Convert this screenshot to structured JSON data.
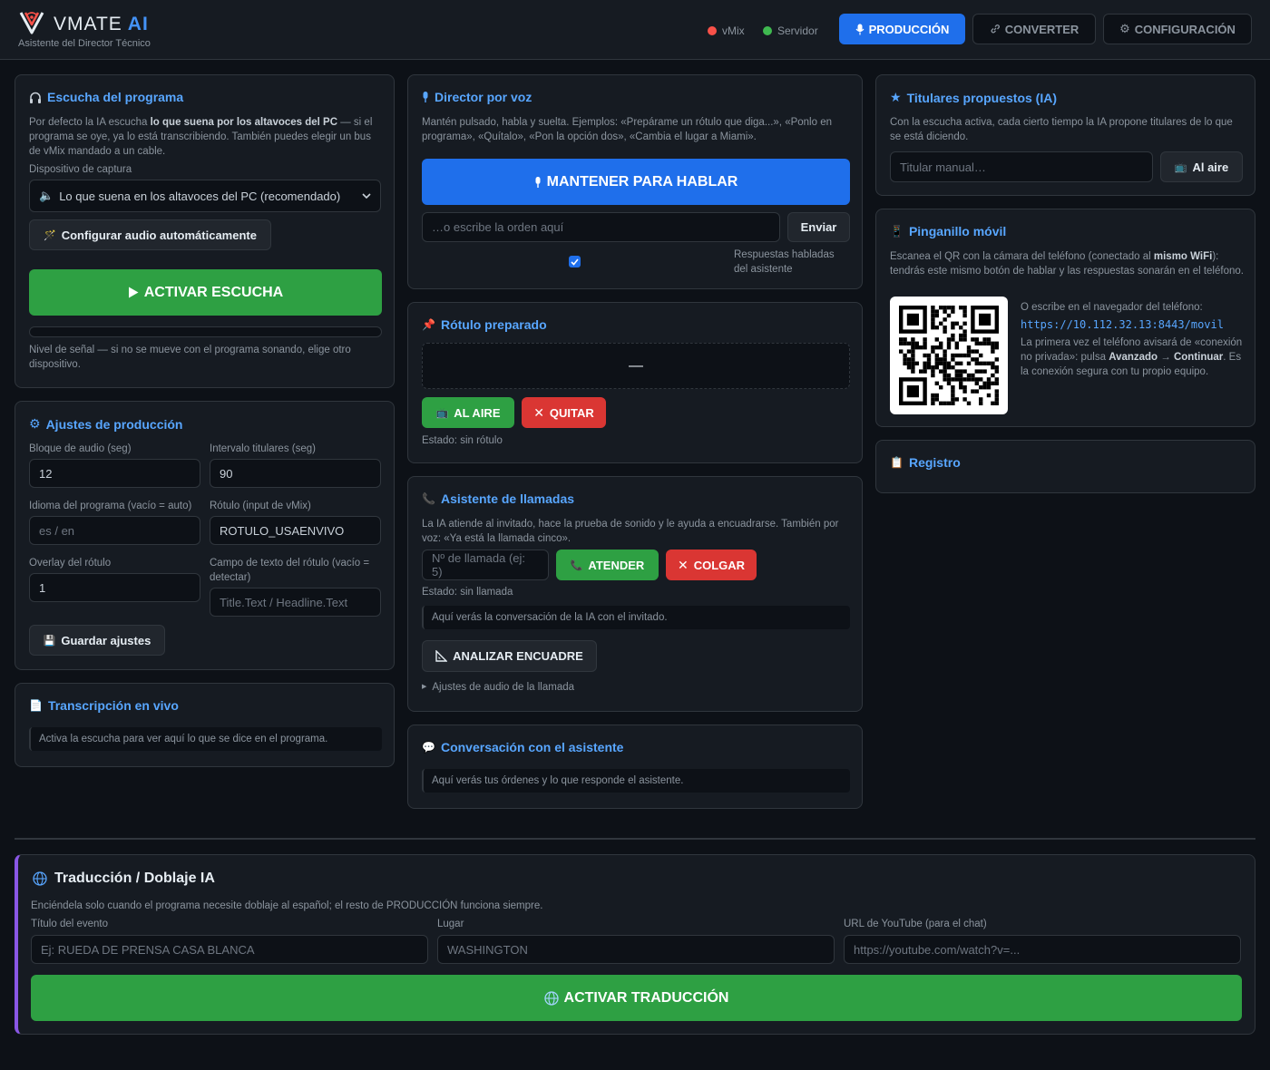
{
  "header": {
    "brand_name": "VMATE",
    "brand_ai": "AI",
    "subtitle": "Asistente del Director Técnico",
    "status_vmix": "vMix",
    "status_server": "Servidor",
    "nav": {
      "produccion": "PRODUCCIÓN",
      "converter": "CONVERTER",
      "configuracion": "CONFIGURACIÓN"
    }
  },
  "colors": {
    "accent": "#1f6feb",
    "link": "#58a6ff",
    "green": "#2ea043",
    "red": "#da3633",
    "purple": "#8957e5",
    "status_vmix": "#f85149",
    "status_server": "#3fb950"
  },
  "escucha": {
    "title": "Escucha del programa",
    "desc_1": "Por defecto la IA escucha ",
    "desc_bold": "lo que suena por los altavoces del PC",
    "desc_2": " — si el programa se oye, ya lo está transcribiendo. También puedes elegir un bus de vMix mandado a un cable.",
    "device_label": "Dispositivo de captura",
    "device_selected": "Lo que suena en los altavoces del PC (recomendado)",
    "auto_audio_btn": "Configurar audio automáticamente",
    "activate_btn": "ACTIVAR ESCUCHA",
    "level_hint": "Nivel de señal — si no se mueve con el programa sonando, elige otro dispositivo."
  },
  "ajustes": {
    "title": "Ajustes de producción",
    "audio_block_label": "Bloque de audio (seg)",
    "audio_block_value": "12",
    "interval_label": "Intervalo titulares (seg)",
    "interval_value": "90",
    "language_label": "Idioma del programa (vacío = auto)",
    "language_placeholder": "es / en",
    "rotulo_label": "Rótulo (input de vMix)",
    "rotulo_value": "ROTULO_USAENVIVO",
    "overlay_label": "Overlay del rótulo",
    "overlay_value": "1",
    "field_label": "Campo de texto del rótulo (vacío = detectar)",
    "field_placeholder": "Title.Text / Headline.Text",
    "save_btn": "Guardar ajustes"
  },
  "transcripcion": {
    "title": "Transcripción en vivo",
    "placeholder": "Activa la escucha para ver aquí lo que se dice en el programa."
  },
  "director": {
    "title": "Director por voz",
    "desc": "Mantén pulsado, habla y suelta. Ejemplos: «Prepárame un rótulo que diga...», «Ponlo en programa», «Quítalo», «Pon la opción dos», «Cambia el lugar a Miami».",
    "talk_btn": "MANTENER PARA HABLAR",
    "input_placeholder": "…o escribe la orden aquí",
    "send_btn": "Enviar",
    "spoken_label": "Respuestas habladas del asistente"
  },
  "rotulo": {
    "title": "Rótulo preparado",
    "preview": "—",
    "air_btn": "AL AIRE",
    "remove_btn": "QUITAR",
    "status": "Estado: sin rótulo"
  },
  "llamadas": {
    "title": "Asistente de llamadas",
    "desc": "La IA atiende al invitado, hace la prueba de sonido y le ayuda a encuadrarse. También por voz: «Ya está la llamada cinco».",
    "call_placeholder": "Nº de llamada (ej: 5)",
    "answer_btn": "ATENDER",
    "hangup_btn": "COLGAR",
    "status": "Estado: sin llamada",
    "log_placeholder": "Aquí verás la conversación de la IA con el invitado.",
    "analyze_btn": "ANALIZAR ENCUADRE",
    "audio_settings": "Ajustes de audio de la llamada"
  },
  "conversacion": {
    "title": "Conversación con el asistente",
    "placeholder": "Aquí verás tus órdenes y lo que responde el asistente."
  },
  "titulares": {
    "title": "Titulares propuestos (IA)",
    "desc": "Con la escucha activa, cada cierto tiempo la IA propone titulares de lo que se está diciendo.",
    "input_placeholder": "Titular manual…",
    "air_btn": "Al aire"
  },
  "pinganillo": {
    "title": "Pinganillo móvil",
    "desc_1": "Escanea el QR con la cámara del teléfono (conectado al ",
    "desc_bold": "mismo WiFi",
    "desc_2": "): tendrás este mismo botón de hablar y las respuestas sonarán en el teléfono.",
    "or_write": "O escribe en el navegador del teléfono:",
    "url": "https://10.112.32.13:8443/movil",
    "note_1": "La primera vez el teléfono avisará de «conexión no privada»: pulsa ",
    "note_b1": "Avanzado",
    "note_2": " → ",
    "note_b2": "Continuar",
    "note_3": ". Es la conexión segura con tu propio equipo."
  },
  "registro": {
    "title": "Registro"
  },
  "traduccion": {
    "title": "Traducción / Doblaje IA",
    "desc": "Enciéndela solo cuando el programa necesite doblaje al español; el resto de PRODUCCIÓN funciona siempre.",
    "event_label": "Título del evento",
    "event_placeholder": "Ej: RUEDA DE PRENSA CASA BLANCA",
    "place_label": "Lugar",
    "place_placeholder": "WASHINGTON",
    "youtube_label": "URL de YouTube (para el chat)",
    "youtube_placeholder": "https://youtube.com/watch?v=...",
    "activate_btn": "ACTIVAR TRADUCCIÓN"
  }
}
